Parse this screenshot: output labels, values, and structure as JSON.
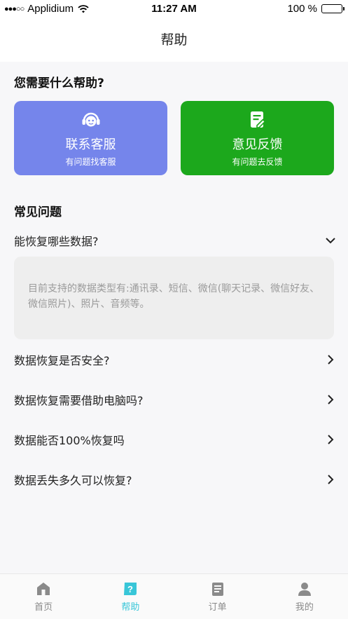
{
  "status_bar": {
    "carrier": "Applidium",
    "time": "11:27 AM",
    "battery": "100 %"
  },
  "header": {
    "title": "帮助"
  },
  "help_section": {
    "title": "您需要什么帮助?",
    "cards": [
      {
        "title": "联系客服",
        "subtitle": "有问题找客服",
        "icon": "headset-icon",
        "color": "#7585eb"
      },
      {
        "title": "意见反馈",
        "subtitle": "有问题去反馈",
        "icon": "edit-note-icon",
        "color": "#1ca81c"
      }
    ]
  },
  "faq": {
    "title": "常见问题",
    "items": [
      {
        "question": "能恢复哪些数据?",
        "expanded": true,
        "answer": "目前支持的数据类型有:通讯录、短信、微信(聊天记录、微信好友、微信照片)、照片、音频等。"
      },
      {
        "question": "数据恢复是否安全?",
        "expanded": false
      },
      {
        "question": "数据恢复需要借助电脑吗?",
        "expanded": false
      },
      {
        "question": "数据能否100%恢复吗",
        "expanded": false
      },
      {
        "question": "数据丢失多久可以恢复?",
        "expanded": false
      }
    ]
  },
  "tab_bar": {
    "active_color": "#38c6d8",
    "tabs": [
      {
        "label": "首页",
        "icon": "home-icon",
        "active": false
      },
      {
        "label": "帮助",
        "icon": "help-icon",
        "active": true
      },
      {
        "label": "订单",
        "icon": "order-icon",
        "active": false
      },
      {
        "label": "我的",
        "icon": "profile-icon",
        "active": false
      }
    ]
  }
}
